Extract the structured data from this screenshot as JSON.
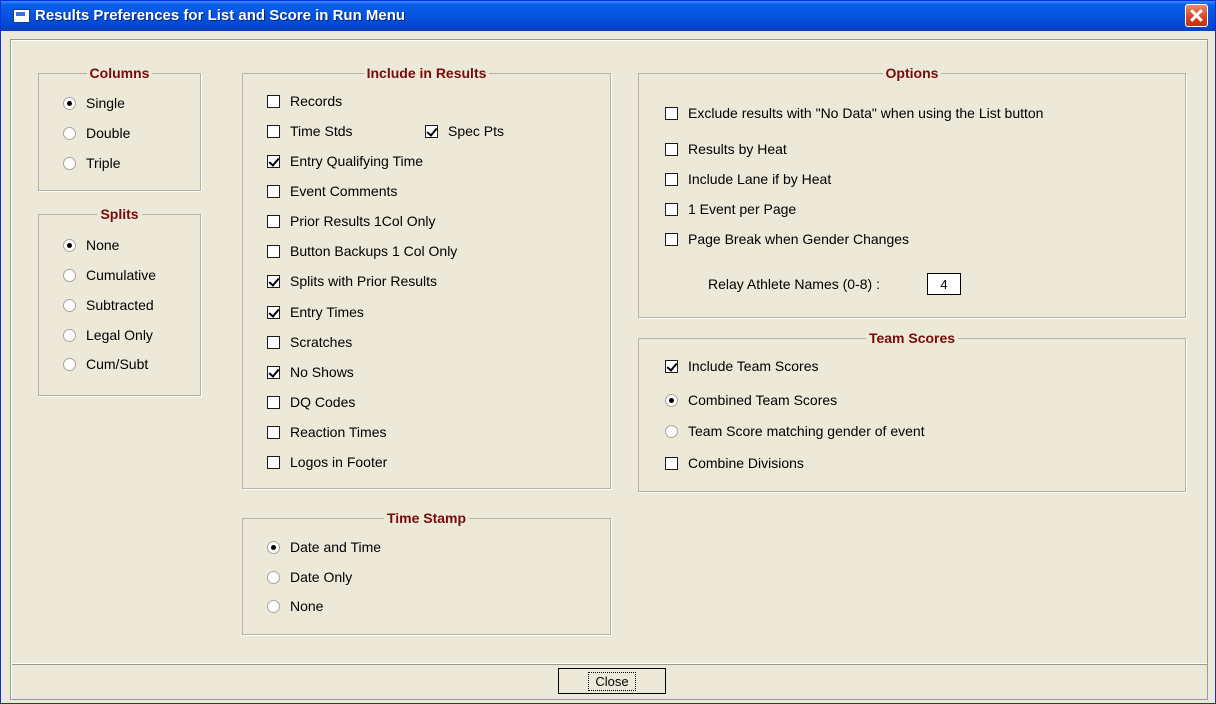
{
  "window": {
    "title": "Results Preferences for List and Score in Run Menu"
  },
  "columns": {
    "legend": "Columns",
    "options": [
      {
        "label": "Single",
        "checked": true
      },
      {
        "label": "Double",
        "checked": false
      },
      {
        "label": "Triple",
        "checked": false
      }
    ]
  },
  "splits": {
    "legend": "Splits",
    "options": [
      {
        "label": "None",
        "checked": true
      },
      {
        "label": "Cumulative",
        "checked": false
      },
      {
        "label": "Subtracted",
        "checked": false
      },
      {
        "label": "Legal Only",
        "checked": false
      },
      {
        "label": "Cum/Subt",
        "checked": false
      }
    ]
  },
  "include": {
    "legend": "Include in Results",
    "items": [
      {
        "label": "Records",
        "checked": false
      },
      {
        "label": "Time Stds",
        "checked": false
      },
      {
        "label": "Spec Pts",
        "checked": true
      },
      {
        "label": "Entry Qualifying Time",
        "checked": true
      },
      {
        "label": "Event Comments",
        "checked": false
      },
      {
        "label": "Prior Results 1Col Only",
        "checked": false
      },
      {
        "label": "Button Backups 1 Col Only",
        "checked": false
      },
      {
        "label": "Splits with Prior Results",
        "checked": true
      },
      {
        "label": "Entry Times",
        "checked": true
      },
      {
        "label": "Scratches",
        "checked": false
      },
      {
        "label": "No Shows",
        "checked": true
      },
      {
        "label": "DQ Codes",
        "checked": false
      },
      {
        "label": "Reaction Times",
        "checked": false
      },
      {
        "label": "Logos in Footer",
        "checked": false
      }
    ]
  },
  "timestamp": {
    "legend": "Time Stamp",
    "options": [
      {
        "label": "Date and Time",
        "checked": true
      },
      {
        "label": "Date Only",
        "checked": false
      },
      {
        "label": "None",
        "checked": false
      }
    ]
  },
  "options": {
    "legend": "Options",
    "items": [
      {
        "label": "Exclude results with \"No Data\" when using the List button",
        "checked": false
      },
      {
        "label": "Results by Heat",
        "checked": false
      },
      {
        "label": "Include Lane if by Heat",
        "checked": false
      },
      {
        "label": "1 Event per Page",
        "checked": false
      },
      {
        "label": "Page Break when Gender Changes",
        "checked": false
      }
    ],
    "relay_label": "Relay Athlete Names (0-8) :",
    "relay_value": "4"
  },
  "team": {
    "legend": "Team Scores",
    "include": {
      "label": "Include Team Scores",
      "checked": true
    },
    "options": [
      {
        "label": "Combined Team Scores",
        "checked": true
      },
      {
        "label": "Team Score matching gender of event",
        "checked": false
      }
    ],
    "combine": {
      "label": "Combine Divisions",
      "checked": false
    }
  },
  "buttons": {
    "close": "Close"
  }
}
